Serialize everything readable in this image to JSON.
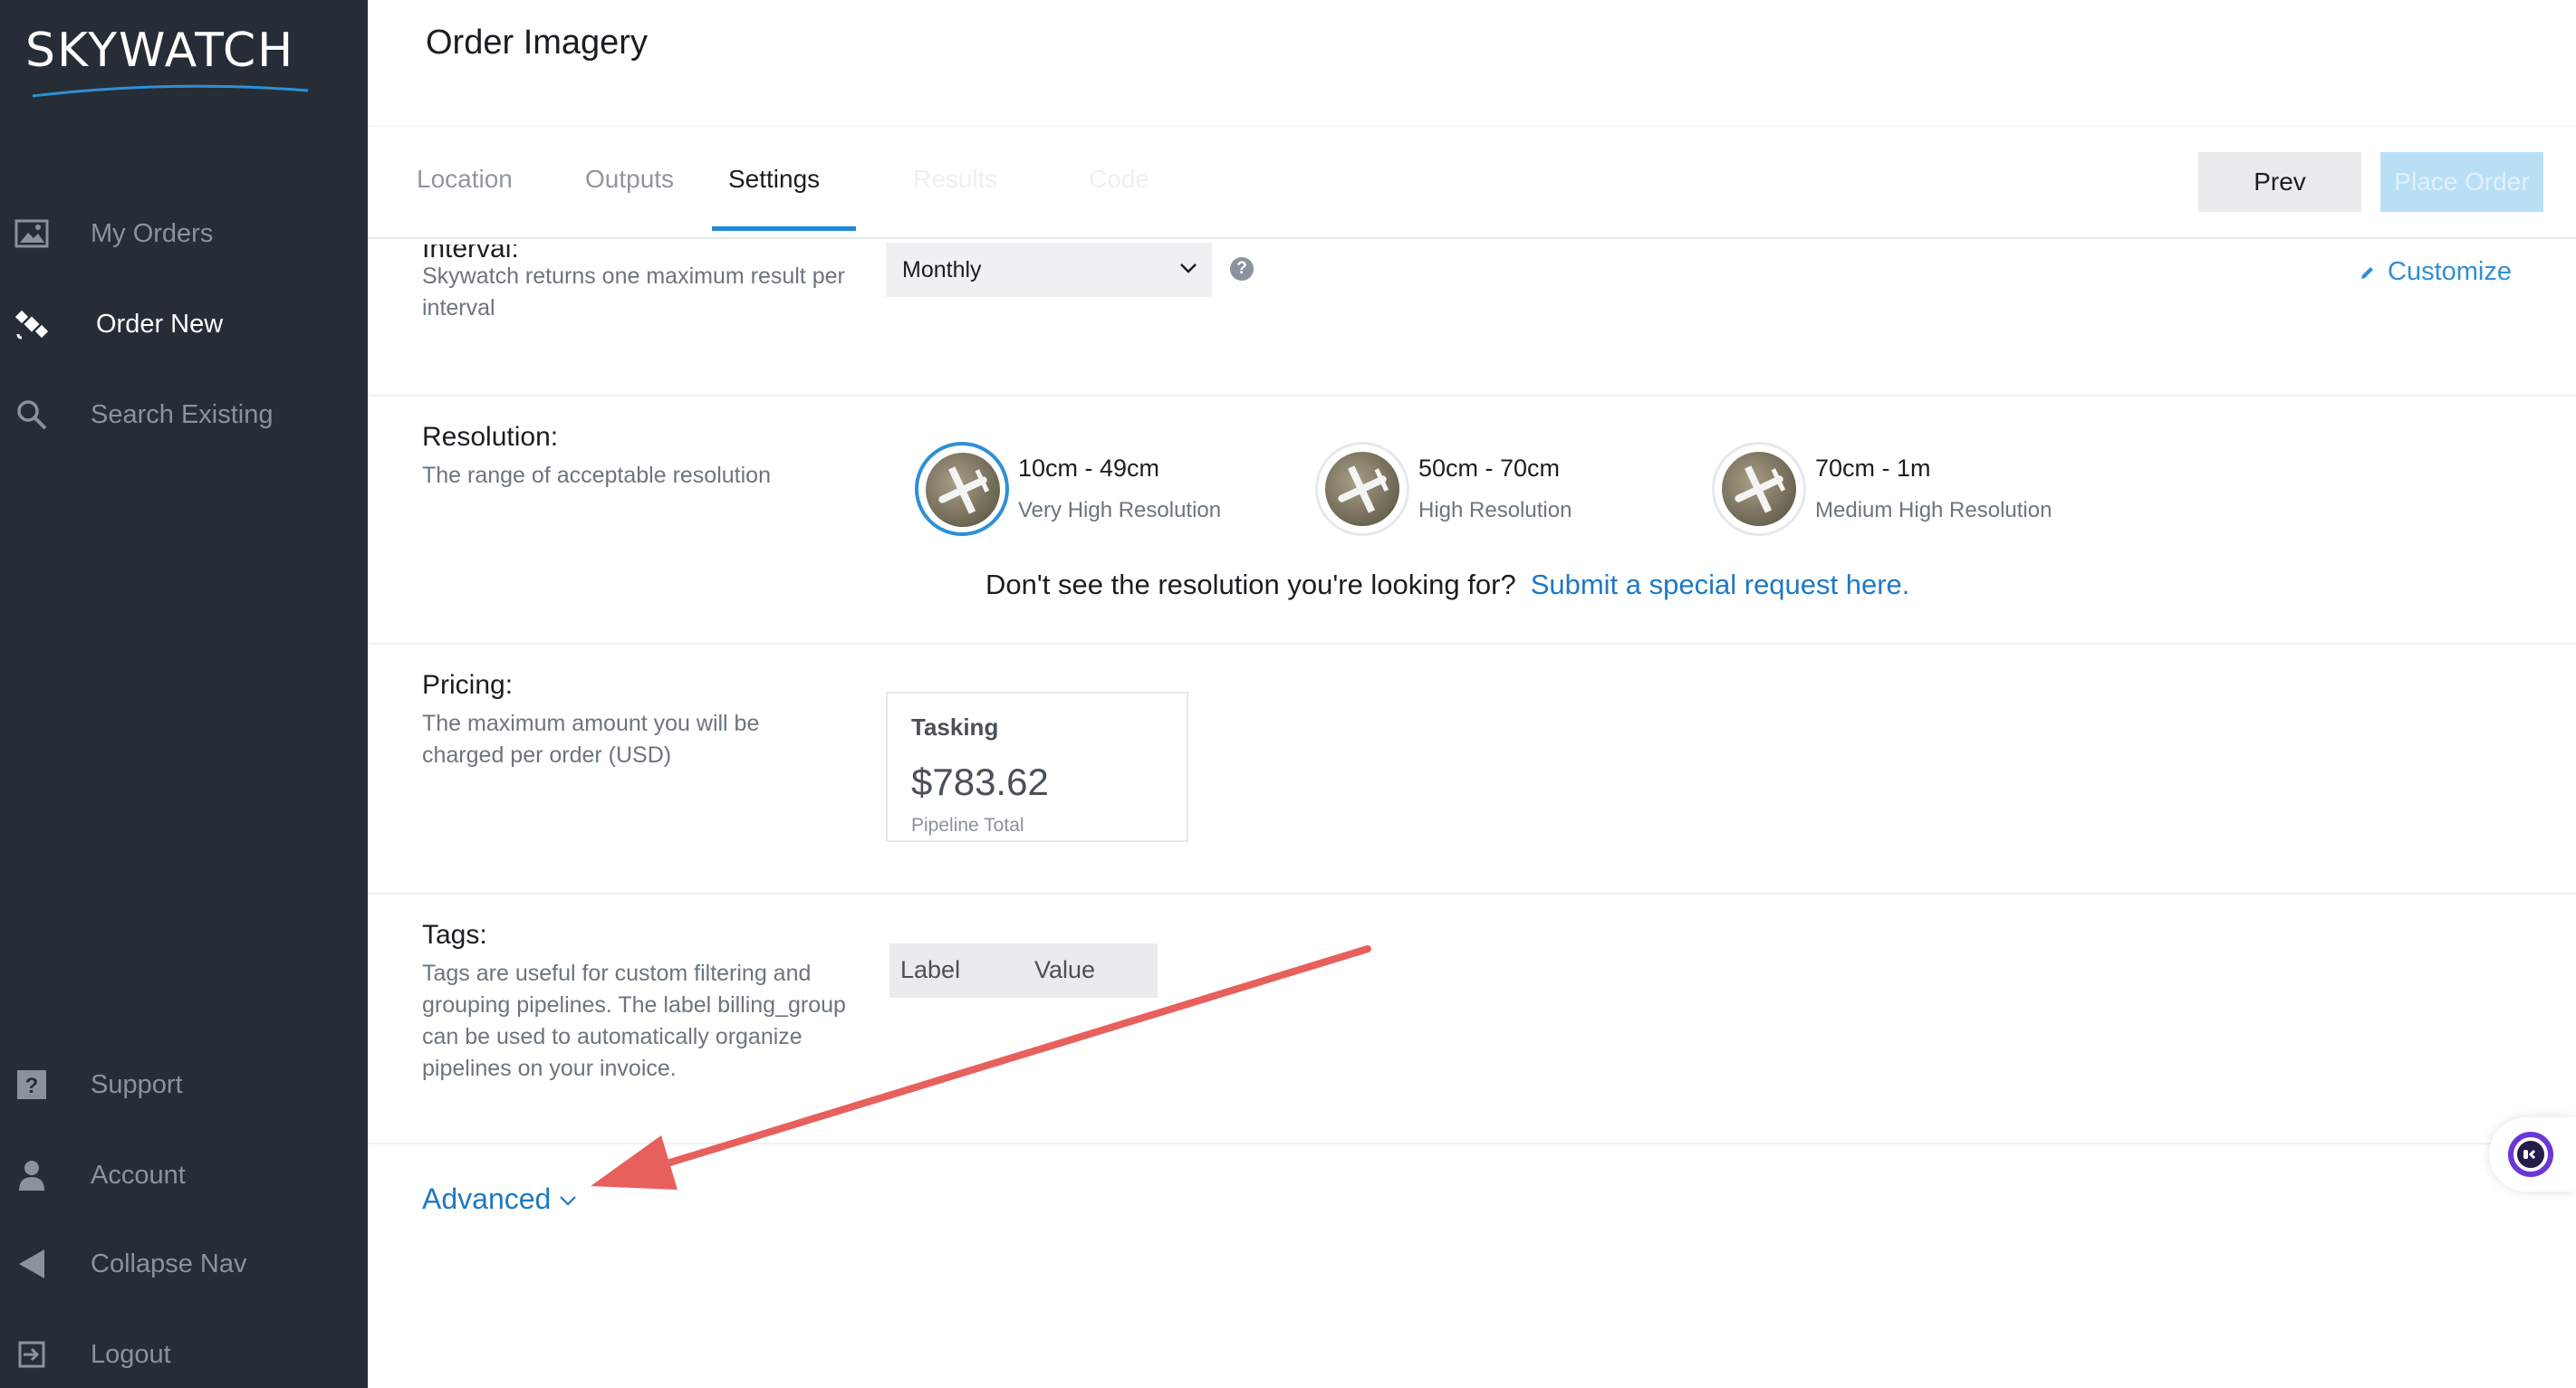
{
  "brand": {
    "logo_text": "SKYWATCH"
  },
  "sidebar": {
    "items": [
      {
        "label": "My Orders",
        "icon": "image-icon"
      },
      {
        "label": "Order New",
        "icon": "satellite-icon",
        "active": true
      },
      {
        "label": "Search Existing",
        "icon": "search-icon"
      },
      {
        "label": "Support",
        "icon": "question-icon"
      },
      {
        "label": "Account",
        "icon": "user-icon"
      },
      {
        "label": "Collapse Nav",
        "icon": "triangle-left-icon"
      },
      {
        "label": "Logout",
        "icon": "logout-icon"
      }
    ]
  },
  "header": {
    "title": "Order Imagery"
  },
  "tabs": [
    {
      "label": "Location",
      "state": "normal"
    },
    {
      "label": "Outputs",
      "state": "normal"
    },
    {
      "label": "Settings",
      "state": "active"
    },
    {
      "label": "Results",
      "state": "disabled"
    },
    {
      "label": "Code",
      "state": "disabled"
    }
  ],
  "actions": {
    "prev_label": "Prev",
    "place_order_label": "Place Order"
  },
  "interval": {
    "title": "Interval:",
    "description": "Skywatch returns one maximum result per interval",
    "selected": "Monthly",
    "customize_label": "Customize"
  },
  "resolution": {
    "title": "Resolution:",
    "description": "The range of acceptable resolution",
    "options": [
      {
        "name": "10cm - 49cm",
        "sub": "Very High Resolution",
        "selected": true
      },
      {
        "name": "50cm - 70cm",
        "sub": "High Resolution",
        "selected": false
      },
      {
        "name": "70cm - 1m",
        "sub": "Medium High Resolution",
        "selected": false
      }
    ],
    "special_request_text": "Don't see the resolution you're looking for?",
    "special_request_link": "Submit a special request here."
  },
  "pricing": {
    "title": "Pricing:",
    "description": "The maximum amount you will be charged per order (USD)",
    "card_title": "Tasking",
    "card_value": "$783.62",
    "card_sub": "Pipeline Total"
  },
  "tags": {
    "title": "Tags:",
    "description": "Tags are useful for custom filtering and grouping pipelines. The label billing_group can be used to automatically organize pipelines on your invoice.",
    "col_label": "Label",
    "col_value": "Value"
  },
  "advanced": {
    "label": "Advanced"
  },
  "colors": {
    "sidebar_bg": "#262d36",
    "accent": "#2f8fd6",
    "link": "#1f78c2",
    "annotation_arrow": "#e8605c"
  }
}
